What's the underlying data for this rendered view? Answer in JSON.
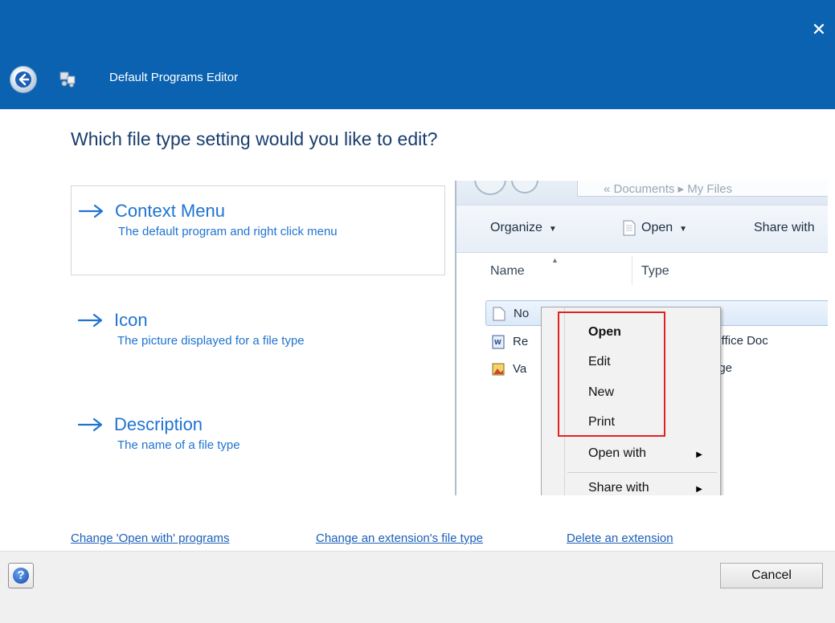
{
  "window": {
    "title": "Default Programs Editor",
    "close_glyph": "✕"
  },
  "question": "Which file type setting would you like to edit?",
  "options": [
    {
      "title": "Context Menu",
      "desc": "The default program and right click menu"
    },
    {
      "title": "Icon",
      "desc": "The picture displayed for a file type"
    },
    {
      "title": "Description",
      "desc": "The name of a file type"
    }
  ],
  "preview": {
    "address": "« Documents ▸ My Files",
    "toolbar": {
      "organize": "Organize",
      "open": "Open",
      "share": "Share with"
    },
    "columns": {
      "name": "Name",
      "type": "Type"
    },
    "files": [
      {
        "name": "No",
        "type": ""
      },
      {
        "name": "Re",
        "type": "Office Doc"
      },
      {
        "name": "Va",
        "type": "age"
      }
    ],
    "context_menu": {
      "items": [
        "Open",
        "Edit",
        "New",
        "Print",
        "Open with",
        "Share with"
      ]
    }
  },
  "links": {
    "open_with": "Change 'Open with' programs",
    "extension_type": "Change an extension's file type",
    "delete_extension": "Delete an extension"
  },
  "footer": {
    "help_glyph": "?",
    "cancel": "Cancel"
  },
  "colors": {
    "titlebar": "#0a62b0",
    "link": "#1f73d1",
    "highlight_border": "#e22222"
  }
}
